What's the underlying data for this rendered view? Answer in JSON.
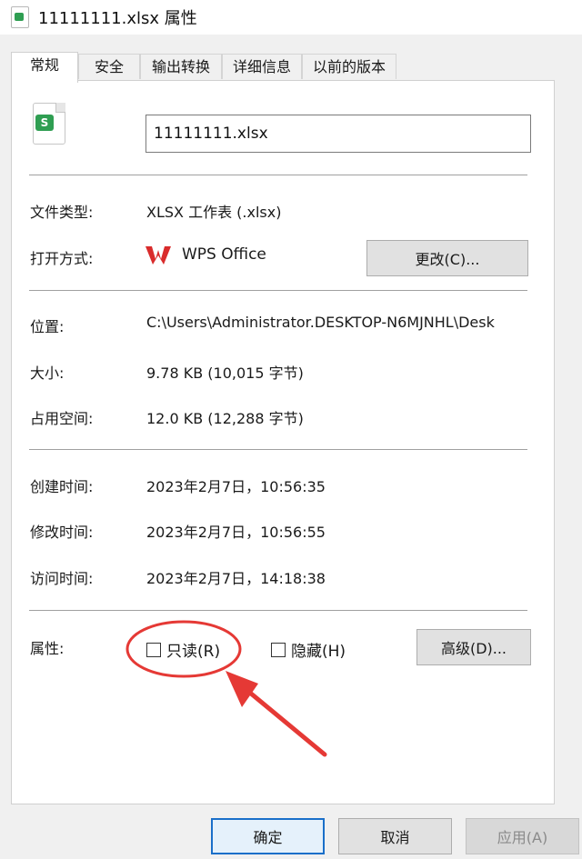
{
  "window": {
    "title": "11111111.xlsx 属性"
  },
  "tabs": [
    {
      "label": "常规",
      "active": true
    },
    {
      "label": "安全",
      "active": false
    },
    {
      "label": "输出转换",
      "active": false
    },
    {
      "label": "详细信息",
      "active": false
    },
    {
      "label": "以前的版本",
      "active": false
    }
  ],
  "file": {
    "icon_text": "S",
    "name": "11111111.xlsx"
  },
  "general": {
    "type_label": "文件类型:",
    "type_value": "XLSX 工作表 (.xlsx)",
    "open_label": "打开方式:",
    "open_value": "WPS Office",
    "change_button": "更改(C)...",
    "location_label": "位置:",
    "location_value": "C:\\Users\\Administrator.DESKTOP-N6MJNHL\\Desk",
    "size_label": "大小:",
    "size_value": "9.78 KB (10,015 字节)",
    "disk_label": "占用空间:",
    "disk_value": "12.0 KB (12,288 字节)",
    "created_label": "创建时间:",
    "created_value": "2023年2月7日，10:56:35",
    "modified_label": "修改时间:",
    "modified_value": "2023年2月7日，10:56:55",
    "accessed_label": "访问时间:",
    "accessed_value": "2023年2月7日，14:18:38",
    "attributes_label": "属性:",
    "readonly_label": "只读(R)",
    "readonly_checked": false,
    "hidden_label": "隐藏(H)",
    "hidden_checked": false,
    "advanced_button": "高级(D)..."
  },
  "footer": {
    "ok": "确定",
    "cancel": "取消",
    "apply": "应用(A)"
  },
  "colors": {
    "annotation": "#e53935",
    "wps_red": "#d92c2c",
    "excel_green": "#2f9e52"
  },
  "icons": {
    "file": "xlsx-file-icon",
    "app": "wps-logo-icon"
  }
}
